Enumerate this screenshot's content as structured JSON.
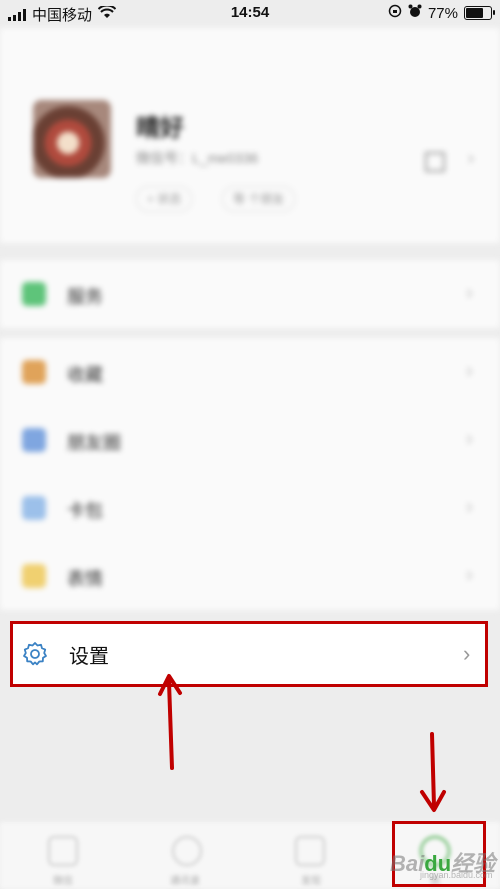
{
  "status_bar": {
    "carrier": "中国移动",
    "time": "14:54",
    "battery_percent": "77%",
    "battery_level": 0.77
  },
  "profile": {
    "nickname": "晴好",
    "wechat_id": "微信号：L_me0336",
    "status_chip": "+ 状态",
    "friends_chip": "等 个朋友"
  },
  "menu": {
    "group1": [
      {
        "label": "服务",
        "icon": "service-icon",
        "color": "#5ec47a"
      }
    ],
    "group2": [
      {
        "label": "收藏",
        "icon": "favorites-icon",
        "color": "#e0a35a"
      },
      {
        "label": "朋友圈",
        "icon": "moments-icon",
        "color": "#7fa6e0"
      },
      {
        "label": "卡包",
        "icon": "cards-icon",
        "color": "#9cc0ea"
      },
      {
        "label": "表情",
        "icon": "stickers-icon",
        "color": "#f0d070"
      }
    ]
  },
  "settings": {
    "label": "设置",
    "icon": "gear-icon"
  },
  "tabbar": {
    "tabs": [
      {
        "label": "微信",
        "icon": "chat-icon"
      },
      {
        "label": "通讯录",
        "icon": "contacts-icon"
      },
      {
        "label": "发现",
        "icon": "discover-icon"
      },
      {
        "label": "我",
        "icon": "me-icon"
      }
    ]
  },
  "watermark": {
    "text": "Bai",
    "du": "du",
    "suffix": "经验",
    "sub": "jingyan.baidu.com"
  },
  "colors": {
    "highlight": "#c00000",
    "accent": "#3aa840"
  }
}
